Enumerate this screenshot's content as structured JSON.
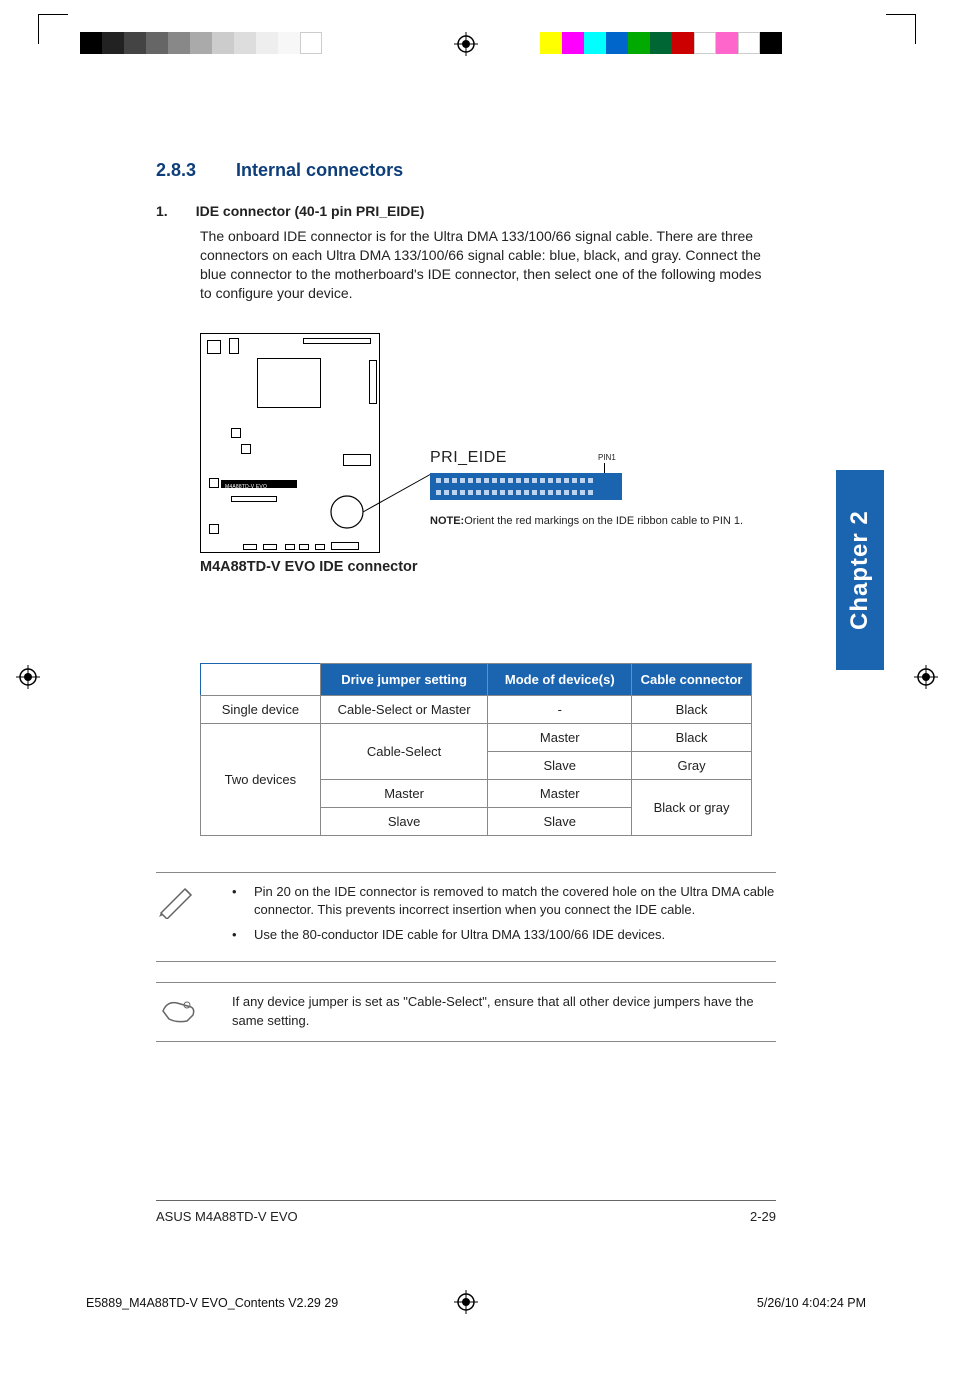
{
  "chapter_tab": "Chapter 2",
  "section": {
    "number": "2.8.3",
    "title": "Internal connectors"
  },
  "item": {
    "number": "1.",
    "title": "IDE connector (40-1 pin PRI_EIDE)"
  },
  "body": "The onboard IDE connector is for the Ultra DMA 133/100/66 signal cable. There are three connectors on each Ultra DMA 133/100/66 signal cable: blue, black, and gray. Connect the blue connector to the motherboard's IDE connector, then select one of the following modes to configure your device.",
  "diagram": {
    "board_label": "M4A88TD-V EVO",
    "caption": "M4A88TD-V EVO IDE connector",
    "pri_label": "PRI_EIDE",
    "pin1": "PIN1",
    "note_bold": "NOTE:",
    "note_text": "Orient the red markings on the IDE ribbon cable to PIN 1."
  },
  "table": {
    "headers": [
      "",
      "Drive jumper setting",
      "Mode of device(s)",
      "Cable connector"
    ],
    "rows": [
      {
        "c0": "Single device",
        "c1": "Cable-Select or Master",
        "c2": "-",
        "c3": "Black"
      },
      {
        "c0_span": "Two devices",
        "c1_span": "Cable-Select",
        "c2": "Master",
        "c3": "Black"
      },
      {
        "c2": "Slave",
        "c3": "Gray"
      },
      {
        "c1": "Master",
        "c2": "Master",
        "c3_span": "Black or gray"
      },
      {
        "c1": "Slave",
        "c2": "Slave"
      }
    ]
  },
  "notes": {
    "pen": [
      "Pin 20 on the IDE connector is removed to match the covered hole on the Ultra DMA cable connector. This prevents incorrect insertion when you connect the IDE cable.",
      "Use the 80-conductor IDE cable for Ultra DMA 133/100/66 IDE devices."
    ],
    "hand": "If any device jumper is set as \"Cable-Select\", ensure that all other device jumpers have the same setting."
  },
  "footer": {
    "left": "ASUS M4A88TD-V EVO",
    "right": "2-29"
  },
  "print_footer": {
    "left": "E5889_M4A88TD-V EVO_Contents V2.29   29",
    "right": "5/26/10   4:04:24 PM"
  }
}
